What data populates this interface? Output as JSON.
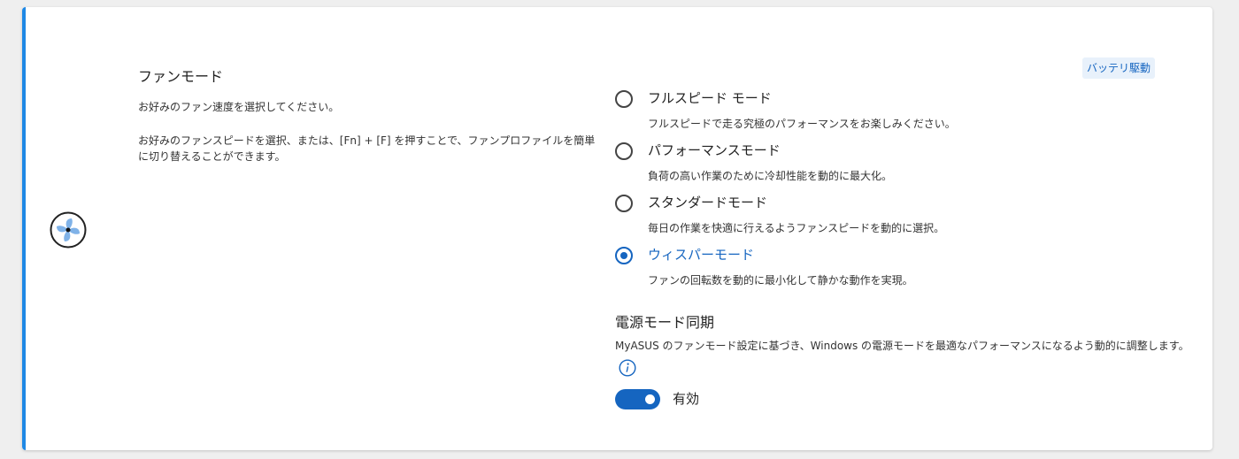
{
  "fan_mode": {
    "title": "ファンモード",
    "description_1": "お好みのファン速度を選択してください。",
    "description_2": "お好みのファンスピードを選択、または、[Fn] + [F] を押すことで、ファンプロファイルを簡単に切り替えることができます。",
    "battery_badge": "バッテリ駆動",
    "options": [
      {
        "label": "フルスピード モード",
        "description": "フルスピードで走る究極のパフォーマンスをお楽しみください。",
        "selected": false
      },
      {
        "label": "パフォーマンスモード",
        "description": "負荷の高い作業のために冷却性能を動的に最大化。",
        "selected": false
      },
      {
        "label": "スタンダードモード",
        "description": "毎日の作業を快適に行えるようファンスピードを動的に選択。",
        "selected": false
      },
      {
        "label": "ウィスパーモード",
        "description": "ファンの回転数を動的に最小化して静かな動作を実現。",
        "selected": true
      }
    ]
  },
  "power_sync": {
    "title": "電源モード同期",
    "description": "MyASUS のファンモード設定に基づき、Windows の電源モードを最適なパフォーマンスになるよう動的に調整します。",
    "toggle_on": true,
    "toggle_label": "有効"
  },
  "icons": {
    "fan": "fan-icon",
    "info": "info-icon"
  },
  "colors": {
    "accent": "#1e88e5",
    "selected": "#1565c0",
    "badge_bg": "#e8f1fb"
  }
}
